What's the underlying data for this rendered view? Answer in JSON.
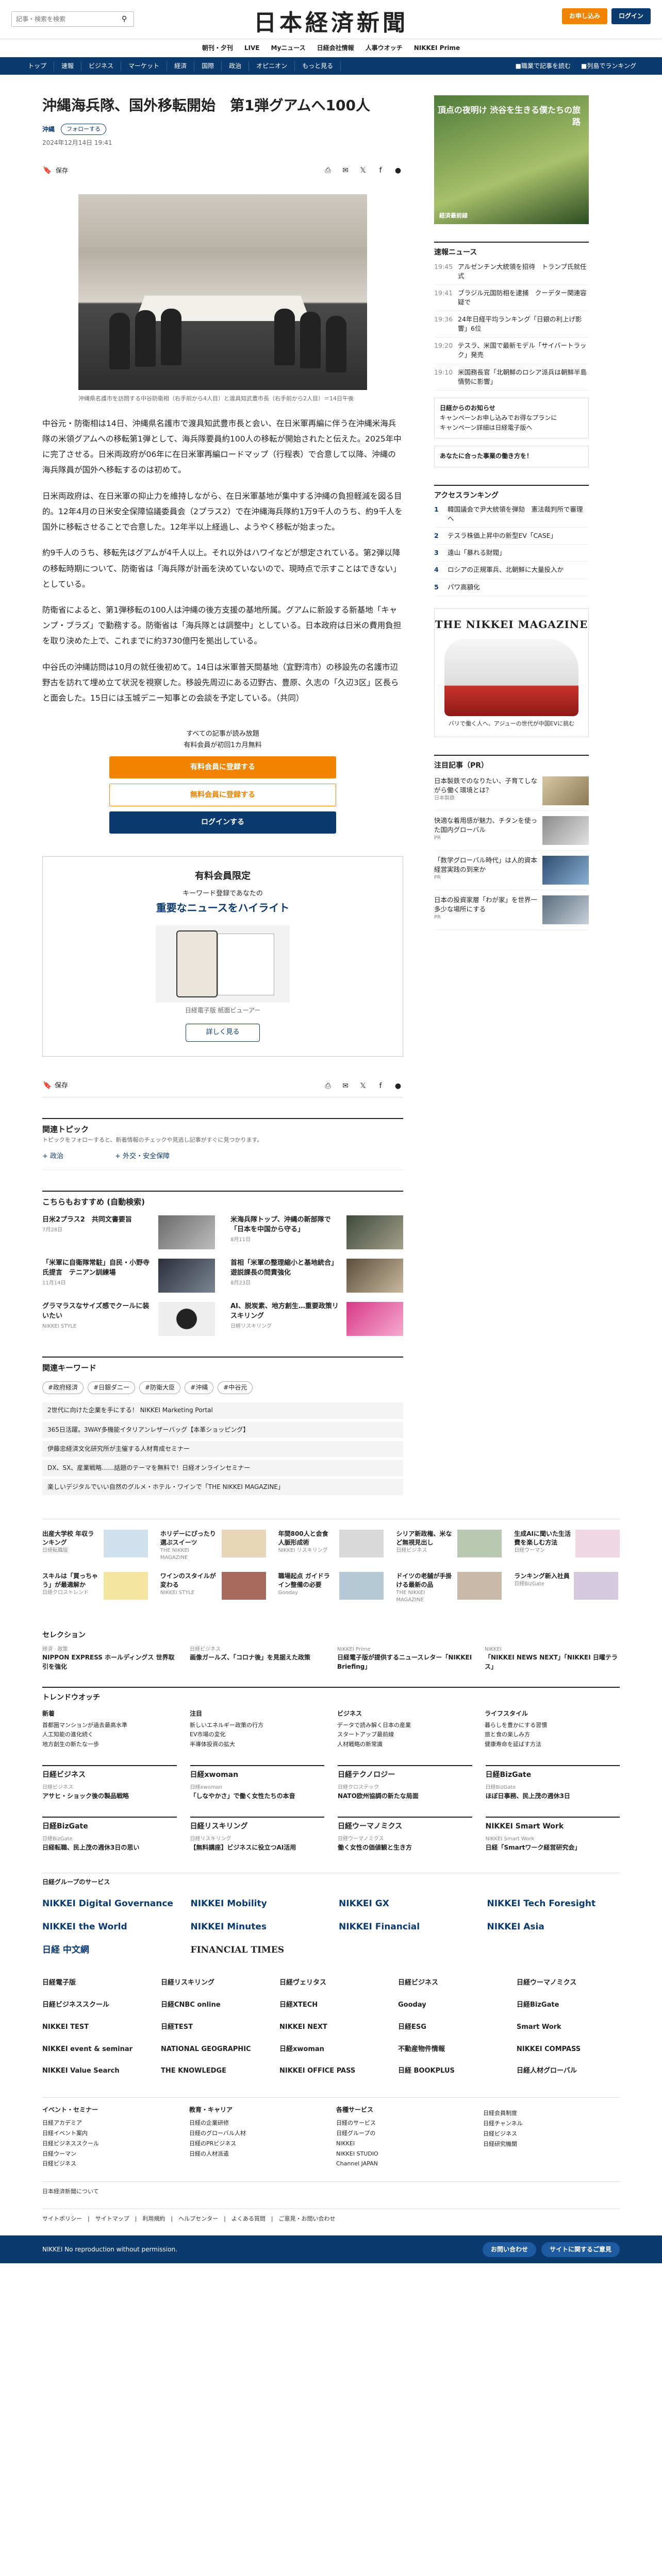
{
  "header": {
    "search_placeholder": "記事・検索を検索",
    "logo": "日本経済新聞",
    "btn_primary": "お申し込み",
    "btn_login": "ログイン",
    "sub_nav": [
      "朝刊・夕刊",
      "LIVE",
      "Myニュース",
      "日経会社情報",
      "人事ウオッチ",
      "NIKKEI Prime"
    ],
    "main_nav": [
      "トップ",
      "速報",
      "ビジネス",
      "マーケット",
      "経済",
      "国際",
      "政治",
      "オピニオン",
      "もっと見る"
    ],
    "right_nav": [
      "■職業で記事を読む",
      "■列島でランキング"
    ]
  },
  "article": {
    "title": "沖縄海兵隊、国外移転開始　第1弾グアムへ100人",
    "tag": "沖縄",
    "follow": "フォローする",
    "date": "2024年12月14日 19:41",
    "save": "保存",
    "caption": "沖縄県名護市を訪問する中谷防衛相（右手前から4人目）と渡具知武豊市長（右手前から2人目）＝14日午後",
    "paragraphs": [
      "中谷元・防衛相は14日、沖縄県名護市で渡具知武豊市長と会い、在日米軍再編に伴う在沖縄米海兵隊の米領グアムへの移転第1弾として、海兵隊要員約100人の移転が開始されたと伝えた。2025年中に完了させる。日米両政府が06年に在日米軍再編ロードマップ（行程表）で合意して以降、沖縄の海兵隊員が国外へ移転するのは初めて。",
      "日米両政府は、在日米軍の抑止力を維持しながら、在日米軍基地が集中する沖縄の負担軽減を図る目的。12年4月の日米安全保障協議委員会（2プラス2）で在沖縄海兵隊約1万9千人のうち、約9千人を国外に移転させることで合意した。12年半以上経過し、ようやく移転が始まった。",
      "約9千人のうち、移転先はグアムが4千人以上。それ以外はハワイなどが想定されている。第2弾以降の移転時期について、防衛省は「海兵隊が計画を決めていないので、現時点で示すことはできない」としている。",
      "防衛省によると、第1弾移転の100人は沖縄の後方支援の基地所属。グアムに新設する新基地「キャンプ・ブラズ」で勤務する。防衛省は「海兵隊とは調整中」としている。日本政府は日米の費用負担を取り決めた上で、これまでに約3730億円を拠出している。",
      "中谷氏の沖縄訪問は10月の就任後初めて。14日は米軍普天間基地（宜野湾市）の移設先の名護市辺野古を訪れて埋め立て状況を視察した。移設先周辺にある辺野古、豊原、久志の「久辺3区」区長らと面会した。15日には玉城デニー知事との会談を予定している。（共同）"
    ]
  },
  "paywall": {
    "lead1": "すべての記事が読み放題",
    "lead2": "有料会員が初回1カ月無料",
    "btn_register": "有料会員に登録する",
    "btn_free": "無料会員に登録する",
    "btn_login": "ログインする"
  },
  "member_box": {
    "title": "有料会員限定",
    "sub": "キーワード登録であなたの",
    "headline": "重要なニュースをハイライト",
    "viewer_caption": "日経電子版 紙面ビューアー",
    "more": "詳しく見る"
  },
  "topics": {
    "title": "関連トピック",
    "sub": "トピックをフォローすると、新着情報のチェックや見逃し記事がすぐに見つかります。",
    "items": [
      "政治",
      "外交・安全保障"
    ]
  },
  "recommend": {
    "title": "こちらもおすすめ (自動検索)",
    "items": [
      {
        "t": "日米2プラス2　共同文書要旨",
        "s": "7月28日"
      },
      {
        "t": "米海兵隊トップ、沖縄の新部隊で「日本を中国から守る」",
        "s": "8月11日"
      },
      {
        "t": "「米軍に自衛隊常駐」自民・小野寺氏提言　テニアン訓練場",
        "s": "11月14日"
      },
      {
        "t": "首相「米軍の整理縮小と基地統合」　遊説課長の問責強化",
        "s": "8月23日"
      },
      {
        "t": "グラマラスなサイズ感でクールに装いたい",
        "s": "NIKKEI STYLE"
      },
      {
        "t": "AI、脱炭素、地方創生…重要政策リスキリング",
        "s": "日経リスキリング"
      }
    ]
  },
  "keywords": {
    "title": "関連キーワード",
    "items": [
      "#政府経済",
      "#日銀ダニー",
      "#防衛大臣",
      "#沖縄",
      "#中谷元"
    ]
  },
  "pr_list": [
    "2世代に向けた企業を手にする！ NIKKEI Marketing Portal",
    "365日活躍。3WAY多機能イタリアンレザーバッグ【本革ショッピング】",
    "伊藤忠経済文化研究所が主催する人材育成セミナー",
    "DX、SX、産業戦略……話題のテーマを無料で！日経オンラインセミナー",
    "楽しいデジタルでいい自然のグルメ・ホテル・ワインで「THE NIKKEI MAGAZINE」"
  ],
  "side": {
    "ad_text": "頂点の夜明け 渋谷を生きる僕たちの旅路",
    "ad_caption": "経済最前線",
    "news_title": "速報ニュース",
    "news": [
      {
        "time": "19:45",
        "t": "アルゼンチン大統領を招待　トランプ氏就任式"
      },
      {
        "time": "19:41",
        "t": "ブラジル元国防相を逮捕　クーデター関連容疑で"
      },
      {
        "time": "19:36",
        "t": "24年日経平均ランキング「日銀の利上げ影響」6位"
      },
      {
        "time": "19:20",
        "t": "テスラ、米国で最新モデル「サイバートラック」発売"
      },
      {
        "time": "19:10",
        "t": "米国務長官「北朝鮮のロシア派兵は朝鮮半島情勢に影響」"
      }
    ],
    "box1": "日経からのお知らせ",
    "box1_items": [
      "キャンペーンお申し込みでお得なプランに",
      "キャンペーン詳細は日経電子版へ"
    ],
    "box2": "あなたに合った事業の働き方を！",
    "ranking_title": "アクセスランキング",
    "ranking": [
      "韓国議会で尹大統領を弾劾　憲法裁判所で審理へ",
      "テスラ株価上昇中の新型EV「CASE」",
      "遠山「暴れる財閥」",
      "ロシアの正規軍兵、北朝鮮に大量投入か",
      "パワ高額化"
    ],
    "mag_title": "THE NIKKEI MAGAZINE",
    "mag_caption": "バリで働く人へ、アジューの世代が中国EVに挑む",
    "pr_title": "注目記事（PR）",
    "pr_items": [
      {
        "t": "日本製鉄でのなりたい、子育てしながら働く環境とは？",
        "s": "日本製鉄"
      },
      {
        "t": "快適な着用感が魅力、チタンを使った国内グローバル",
        "s": "PR"
      },
      {
        "t": "「数学グローバル時代」は人的資本経営実践の到来か",
        "s": "PR"
      },
      {
        "t": "日本の投資家層「わが家」を世界一多少な場所にする",
        "s": "PR"
      }
    ]
  },
  "strip": [
    {
      "t": "出産大学校 年収ランキング",
      "s": "日経転職版"
    },
    {
      "t": "ホリデーにぴったり 選ぶスイーツ",
      "s": "THE NIKKEI MAGAZINE"
    },
    {
      "t": "年間800人と会食 人脈形成術",
      "s": "NIKKEI リスキリング"
    },
    {
      "t": "シリア新政権、米など無視見出し",
      "s": "日経ビジネス"
    },
    {
      "t": "生成AIに聞いた生活費を楽しむ方法",
      "s": "日経ウーマン"
    },
    {
      "t": "スキルは「買っちゃう」が最適解か",
      "s": "日経クロストレンド"
    },
    {
      "t": "ワインのスタイルが変わる",
      "s": "NIKKEI STYLE"
    },
    {
      "t": "職場起点 ガイドライン整備の必要",
      "s": "Gooday"
    },
    {
      "t": "ドイツの老舗が手掛ける最新の品",
      "s": "THE NIKKEI MAGAZINE"
    },
    {
      "t": "ランキング新入社員",
      "s": "日経BizGate"
    }
  ],
  "selection": {
    "title": "セレクション",
    "items": [
      {
        "k": "経済 · 政策",
        "t": "NIPPON EXPRESS ホールディングス 世界取引を強化"
      },
      {
        "k": "日経ビジネス",
        "t": "画像ガールズ、「コロナ後」を見据えた政策"
      },
      {
        "k": "NIKKEI Prime",
        "t": "日経電子版が提供するニュースレター「NIKKEI Briefing」"
      },
      {
        "k": "NIKKEI",
        "t": "「NIKKEI NEWS NEXT」「NIKKEI 日曜テラス」"
      }
    ]
  },
  "trend": {
    "title": "トレンドウオッチ",
    "cols": [
      {
        "c": "新着",
        "items": [
          "首都圏マンションが過去最高水準",
          "人工知能の進化続く",
          "地方創生の新たな一歩"
        ]
      },
      {
        "c": "注目",
        "items": [
          "新しいエネルギー政策の行方",
          "EV市場の変化",
          "半導体投資の拡大"
        ]
      },
      {
        "c": "ビジネス",
        "items": [
          "データで読み解く日本の産業",
          "スタートアップ最前線",
          "人材戦略の新常識"
        ]
      },
      {
        "c": "ライフスタイル",
        "items": [
          "暮らしを豊かにする習慣",
          "旅と食の楽しみ方",
          "健康寿命を延ばす方法"
        ]
      }
    ]
  },
  "media": [
    {
      "h": "日経ビジネス",
      "s": "日経ビジネス",
      "t": "アサヒ・ショック後の製品戦略"
    },
    {
      "h": "日経xwoman",
      "s": "日経xwoman",
      "t": "「しなやかさ」で働く女性たちの本音"
    },
    {
      "h": "日経テクノロジー",
      "s": "日経クロステック",
      "t": "NATO欧州協調の新たな局面"
    },
    {
      "h": "日経BizGate",
      "s": "日経BizGate",
      "t": "ほぼ日事務、民上茂の週休3日"
    }
  ],
  "media2": [
    {
      "h": "日経BizGate",
      "s": "日経BizGate",
      "t": "日経転職、民上茂の週休3日の思い"
    },
    {
      "h": "日経リスキリング",
      "s": "日経リスキリング",
      "t": "【無料講座】ビジネスに役立つAI活用"
    },
    {
      "h": "日経ウーマノミクス",
      "s": "日経ウーマノミクス",
      "t": "働く女性の価値観と生き方"
    },
    {
      "h": "NIKKEI Smart Work",
      "s": "NIKKEI Smart Work",
      "t": "日経「Smartワーク経営研究会」"
    }
  ],
  "brands_h": "日経グループのサービス",
  "brands": [
    "NIKKEI Digital Governance",
    "NIKKEI Mobility",
    "NIKKEI GX",
    "NIKKEI Tech Foresight",
    "NIKKEI the World",
    "NIKKEI Minutes",
    "NIKKEI Financial",
    "NIKKEI Asia",
    "日経 中文網",
    "FINANCIAL TIMES"
  ],
  "brands_small": [
    "日経電子版",
    "日経リスキリング",
    "日経ヴェリタス",
    "日経ビジネス",
    "日経ウーマノミクス",
    "日経ビジネススクール",
    "日経CNBC online",
    "日経XTECH",
    "Gooday",
    "日経BizGate",
    "NIKKEI TEST",
    "日経TEST",
    "NIKKEI NEXT",
    "日経ESG",
    "Smart Work",
    "NIKKEI event & seminar",
    "NATIONAL GEOGRAPHIC",
    "日経xwoman",
    "不動産物件情報",
    "NIKKEI COMPASS",
    "NIKKEI Value Search",
    "THE KNOWLEDGE",
    "NIKKEI OFFICE PASS",
    "日経 BOOKPLUS",
    "日経人材グローバル"
  ],
  "footer": {
    "cols": [
      {
        "h": "イベント・セミナー",
        "items": [
          "日経アカデミア",
          "日経イベント案内",
          "日経ビジネススクール",
          "日経ウーマン",
          "日経ビジネス"
        ]
      },
      {
        "h": "教育・キャリア",
        "items": [
          "日経の企業研修",
          "日経のグローバル人材",
          "日経のPRビジネス",
          "日経の人材派遣"
        ]
      },
      {
        "h": "各種サービス",
        "items": [
          "日経のサービス",
          "日経グループの",
          "NIKKEI",
          "NIKKEI STUDIO",
          "Channel JAPAN"
        ]
      },
      {
        "h": "",
        "items": [
          "日経会員制度",
          "日経チャンネル",
          "日経ビジネス",
          "日経研究機関"
        ]
      }
    ],
    "row1": "日本経済新聞について",
    "row2": "サイトポリシー　|　サイトマップ　|　利用規約　|　ヘルプセンター　|　よくある質問　|　ご意見・お問い合わせ",
    "copy": "NIKKEI  No reproduction without permission.",
    "pill1": "お問い合わせ",
    "pill2": "サイトに関するご意見"
  }
}
